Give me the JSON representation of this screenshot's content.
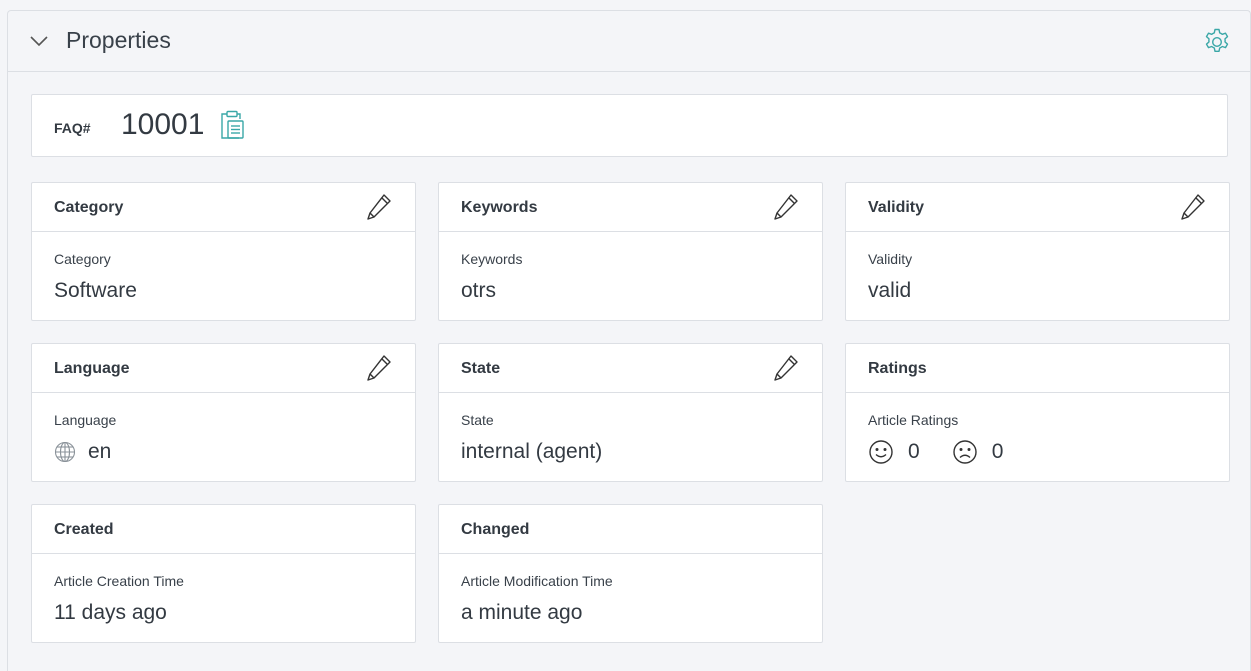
{
  "panel": {
    "title": "Properties",
    "icons": {
      "collapse": "chevron-down-icon",
      "settings": "gear-icon"
    },
    "accent_color": "#3aa7a7"
  },
  "faq": {
    "label": "FAQ#",
    "number": "10001",
    "copy_icon": "clipboard-icon"
  },
  "cards": {
    "category": {
      "title": "Category",
      "label": "Category",
      "value": "Software"
    },
    "keywords": {
      "title": "Keywords",
      "label": "Keywords",
      "value": "otrs"
    },
    "validity": {
      "title": "Validity",
      "label": "Validity",
      "value": "valid"
    },
    "language": {
      "title": "Language",
      "label": "Language",
      "value": "en",
      "icon": "globe-icon"
    },
    "state": {
      "title": "State",
      "label": "State",
      "value": "internal (agent)"
    },
    "ratings": {
      "title": "Ratings",
      "label": "Article Ratings",
      "positive": "0",
      "negative": "0"
    },
    "created": {
      "title": "Created",
      "label": "Article Creation Time",
      "value": "11 days ago"
    },
    "changed": {
      "title": "Changed",
      "label": "Article Modification Time",
      "value": "a minute ago"
    }
  }
}
